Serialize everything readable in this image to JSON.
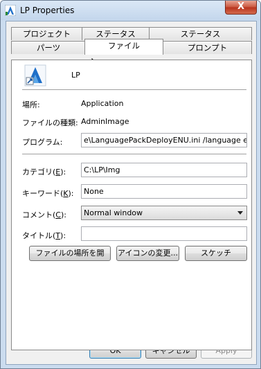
{
  "window": {
    "title": "LP Properties",
    "close_label": "X"
  },
  "tabs_row1": [
    "プロジェクト",
    "ステータス",
    "ステータス"
  ],
  "tabs_row2": [
    "パーツ",
    "ファイル",
    "プロンプト"
  ],
  "file": {
    "name": "LP",
    "location_label": "場所:",
    "location_value": "Application",
    "type_label": "ファイルの種類:",
    "type_value": "AdminImage",
    "program_label": "プログラム:",
    "program_value": "e\\LanguagePackDeployENU.ini /language en-us",
    "category_label": "カテゴリ(E):",
    "category_value": "C:\\LP\\Img",
    "keyword_label": "キーワード(K):",
    "keyword_value": "None",
    "comment_label": "コメント(C):",
    "comment_value": "Normal window",
    "title_label": "タイトル(T):",
    "title_value": ""
  },
  "action_buttons": {
    "open_location": "ファイルの場所を開",
    "change_icon": "アイコンの変更...",
    "sketch": "スケッチ"
  },
  "footer": {
    "ok": "OK",
    "cancel": "キャンセル",
    "apply": "Apply"
  },
  "colors": {
    "app_icon_blue": "#1e6fc8",
    "close_red": "#c9553d"
  }
}
